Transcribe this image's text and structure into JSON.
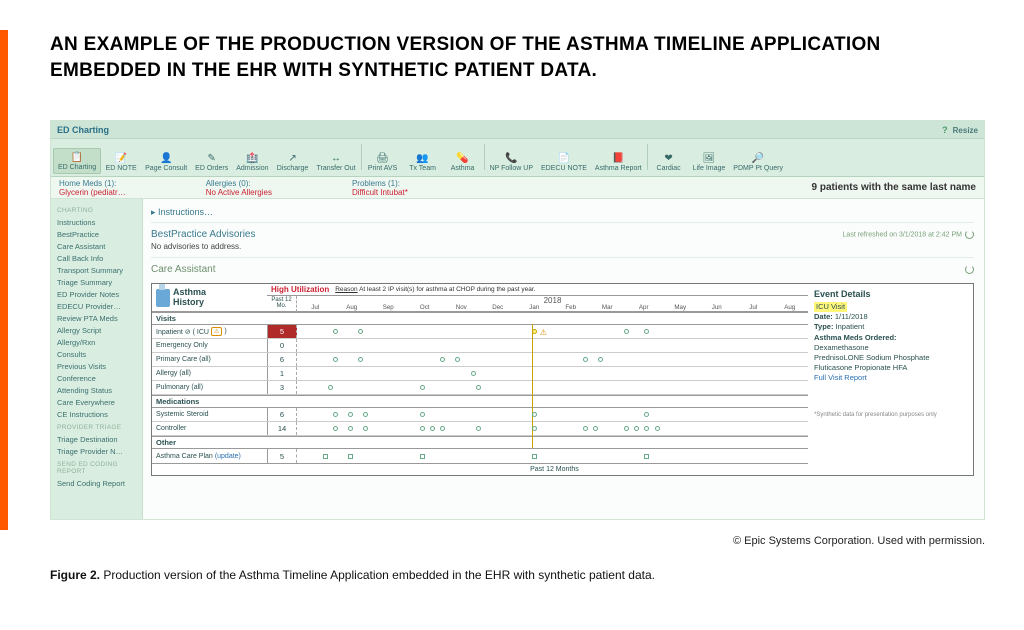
{
  "heading": "AN EXAMPLE OF THE PRODUCTION VERSION OF THE ASTHMA TIMELINE APPLICATION EMBEDDED IN THE EHR WITH SYNTHETIC PATIENT DATA.",
  "titlebar": {
    "text": "ED Charting",
    "resize": "Resize",
    "help": "?"
  },
  "toolbar": [
    {
      "label": "ED Charting",
      "icon": "📋",
      "active": true
    },
    {
      "label": "ED NOTE",
      "icon": "📝"
    },
    {
      "label": "Page Consult",
      "icon": "👤"
    },
    {
      "label": "ED Orders",
      "icon": "✎"
    },
    {
      "label": "Admission",
      "icon": "🏥"
    },
    {
      "label": "Discharge",
      "icon": "↗"
    },
    {
      "label": "Transfer Out",
      "icon": "↔"
    },
    {
      "sep": true
    },
    {
      "label": "Print AVS",
      "icon": "🖨"
    },
    {
      "label": "Tx Team",
      "icon": "👥"
    },
    {
      "label": "Asthma",
      "icon": "💊"
    },
    {
      "sep": true
    },
    {
      "label": "NP Follow UP",
      "icon": "📞"
    },
    {
      "label": "EDECU NOTE",
      "icon": "📄"
    },
    {
      "label": "Asthma Report",
      "icon": "📕"
    },
    {
      "sep": true
    },
    {
      "label": "Cardiac",
      "icon": "❤"
    },
    {
      "label": "Life Image",
      "icon": "🖼"
    },
    {
      "label": "PDMP Pt Query",
      "icon": "🔎"
    }
  ],
  "alerts": {
    "left": [
      {
        "title": "Home Meds (1):",
        "value": "Glycerin (pediatr…"
      },
      {
        "title": "Allergies (0):",
        "value": "No Active Allergies"
      },
      {
        "title": "Problems (1):",
        "value": "Difficult Intubat*"
      }
    ],
    "right": "9 patients with the same last name"
  },
  "sidebar": {
    "g1": "Charting",
    "items1": [
      "Instructions",
      "BestPractice",
      "Care Assistant",
      "Call Back Info",
      "Transport Summary",
      "Triage Summary",
      "ED Provider Notes",
      "EDECU Provider…",
      "Review PTA Meds",
      "Allergy Script",
      "Allergy/Rxn",
      "Consults",
      "Previous Visits",
      "Conference",
      "Attending Status",
      "Care Everywhere",
      "CE Instructions"
    ],
    "g2": "Provider Triage",
    "items2": [
      "Triage Destination",
      "Triage Provider N…"
    ],
    "g3": "Send ED Coding Report",
    "items3": [
      "Send Coding Report"
    ]
  },
  "main": {
    "instructions": "▸ Instructions…",
    "bp_title": "BestPractice Advisories",
    "bp_refresh": "Last refreshed on 3/1/2018 at 2:42 PM",
    "bp_body": "No advisories to address.",
    "ca_title": "Care Assistant"
  },
  "timeline": {
    "title1": "Asthma",
    "title2": "History",
    "hu_label": "High Utilization",
    "hu_reason_u": "Reason",
    "hu_reason": " At least 2 IP visit(s) for asthma at CHOP during the past year.",
    "past12": "Past 12 Mo.",
    "year": "2018",
    "months": [
      "Jul",
      "Aug",
      "Sep",
      "Oct",
      "Nov",
      "Dec",
      "Jan",
      "Feb",
      "Mar",
      "Apr",
      "May",
      "Jun",
      "Jul",
      "Aug"
    ],
    "sections": [
      {
        "header": "Visits",
        "rows": [
          {
            "label": "Inpatient ⊘ ( ICU",
            "badge": "⚠",
            "label2": " )",
            "count": "5",
            "red": true
          },
          {
            "label": "Emergency Only",
            "count": "0"
          },
          {
            "label": "Primary Care (all)",
            "count": "6"
          },
          {
            "label": "Allergy (all)",
            "count": "1"
          },
          {
            "label": "Pulmonary (all)",
            "count": "3"
          }
        ]
      },
      {
        "header": "Medications",
        "rows": [
          {
            "label": "Systemic Steroid",
            "count": "6"
          },
          {
            "label": "Controller",
            "count": "14"
          }
        ]
      },
      {
        "header": "Other",
        "rows": [
          {
            "label": "Asthma Care Plan ",
            "upd": "(update)",
            "count": "5"
          }
        ]
      }
    ],
    "footer": "Past 12 Months"
  },
  "event": {
    "title": "Event Details",
    "visit": "ICU Visit",
    "date_l": "Date: ",
    "date_v": "1/11/2018",
    "type_l": "Type: ",
    "type_v": "Inpatient",
    "meds_l": "Asthma Meds Ordered:",
    "meds": [
      "Dexamethasone",
      "PrednisoLONE Sodium Phosphate",
      "Fluticasone Propionate HFA"
    ],
    "link": "Full Visit Report",
    "foot": "*Synthetic data for presentation purposes only"
  },
  "copyright": "© Epic Systems Corporation. Used with permission.",
  "caption_b": "Figure 2. ",
  "caption": "Production version of the Asthma Timeline Application embedded in the EHR with synthetic patient data."
}
